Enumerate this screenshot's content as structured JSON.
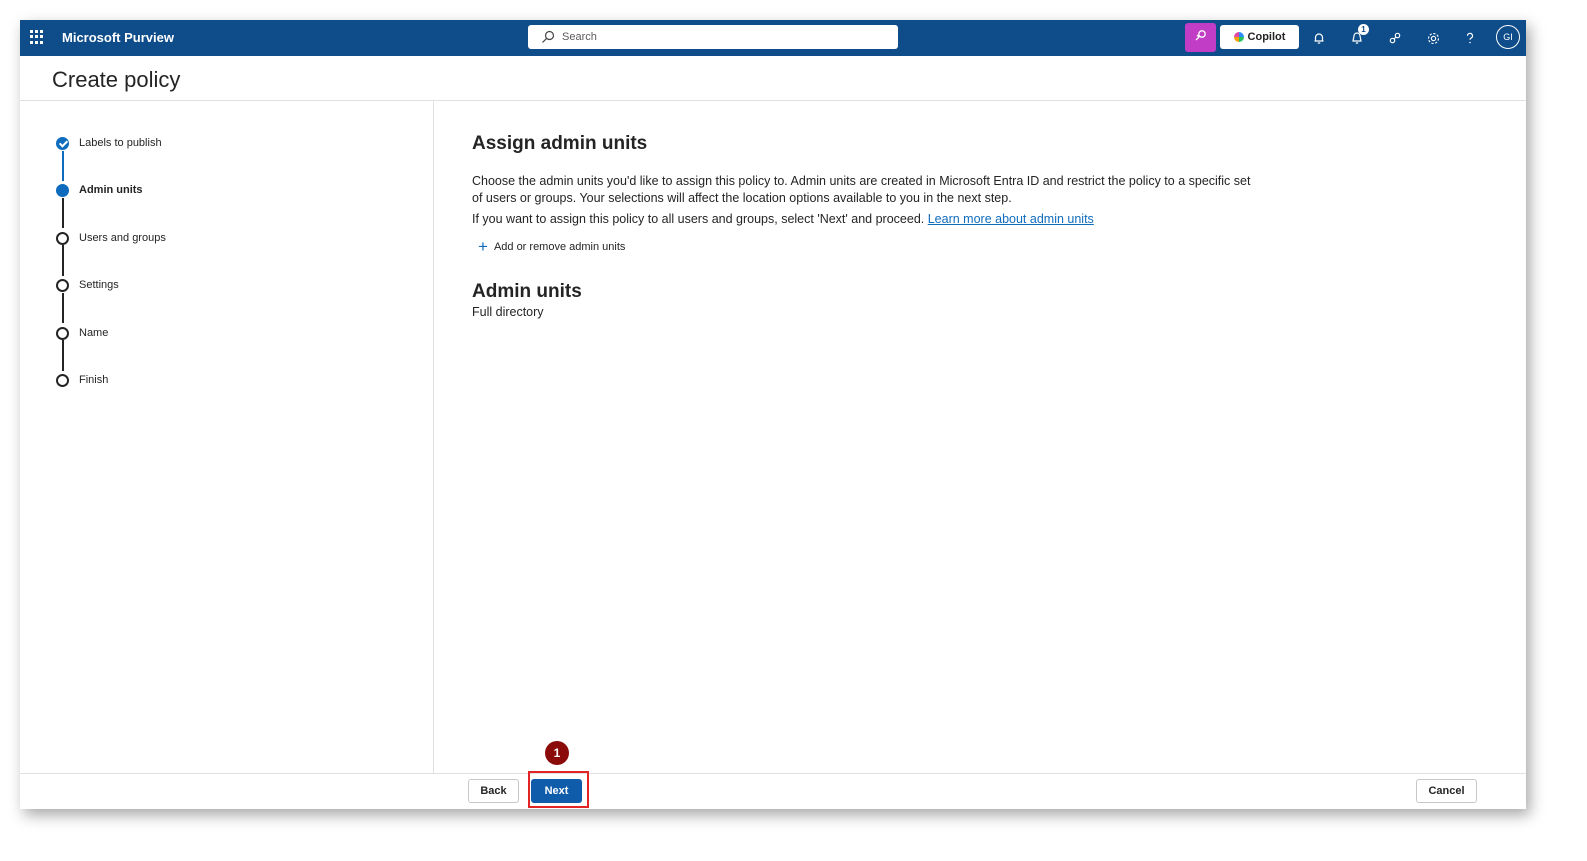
{
  "topbar": {
    "app_name": "Microsoft Purview",
    "search_placeholder": "Search",
    "copilot_label": "Copilot",
    "notification_count": "1",
    "avatar_initials": "GI",
    "bar_color": "#0f4c8a",
    "icons": [
      "app-launcher-icon",
      "search-icon",
      "purview-agent-icon",
      "copilot-icon",
      "bell-icon",
      "announcement-icon",
      "connections-icon",
      "gear-icon",
      "help-icon"
    ]
  },
  "page": {
    "title": "Create policy"
  },
  "steps": [
    {
      "label": "Labels to publish",
      "state": "completed"
    },
    {
      "label": "Admin units",
      "state": "current"
    },
    {
      "label": "Users and groups",
      "state": "pending"
    },
    {
      "label": "Settings",
      "state": "pending"
    },
    {
      "label": "Name",
      "state": "pending"
    },
    {
      "label": "Finish",
      "state": "pending"
    }
  ],
  "content": {
    "heading": "Assign admin units",
    "description": "Choose the admin units you'd like to assign this policy to. Admin units are created in Microsoft Entra ID and restrict the policy to a specific set of users or groups. Your selections will affect the location options available to you in the next step.",
    "proceed_text": "If you want to assign this policy to all users and groups, select 'Next' and proceed.",
    "learn_more_link": "Learn more about admin units",
    "add_button_label": "Add or remove admin units",
    "admin_units_heading": "Admin units",
    "admin_units_value": "Full directory"
  },
  "footer": {
    "back_label": "Back",
    "next_label": "Next",
    "cancel_label": "Cancel"
  },
  "annotation": {
    "callout_number": "1",
    "callout_color": "#8b0a0a",
    "highlight_color": "#e32424"
  }
}
